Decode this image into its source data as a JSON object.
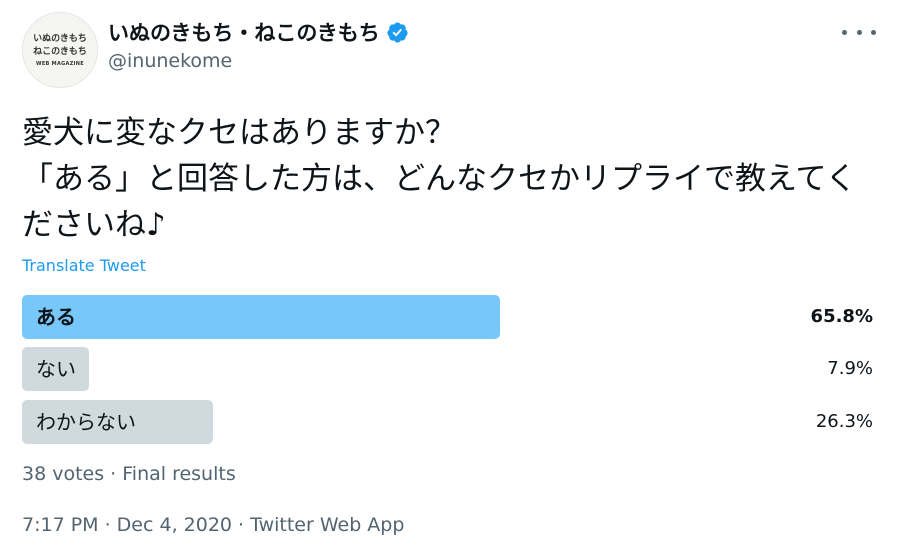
{
  "author": {
    "display_name": "いぬのきもち・ねこのきもち",
    "handle": "@inunekome",
    "avatar_lines": [
      "いぬのきもち",
      "ねこのきもち",
      "WEB MAGAZINE"
    ],
    "verified_icon": "verified-badge-icon"
  },
  "tweet": {
    "text": "愛犬に変なクセはありますか？\n「ある」と回答した方は、どんなクセかリプライで教えてくださいね♪",
    "translate_link": "Translate Tweet"
  },
  "poll": {
    "options": [
      {
        "label": "ある",
        "percent": "65.8%",
        "fraction": 0.658,
        "winner": true
      },
      {
        "label": "ない",
        "percent": "7.9%",
        "fraction": 0.079,
        "winner": false
      },
      {
        "label": "わからない",
        "percent": "26.3%",
        "fraction": 0.263,
        "winner": false
      }
    ],
    "summary": "38 votes · Final results"
  },
  "meta": {
    "timestamp": "7:17 PM · Dec 4, 2020 · Twitter Web App"
  },
  "colors": {
    "winner_bar": "#78c7fb",
    "other_bar": "#cfd9de",
    "link": "#1d9bf0",
    "secondary_text": "#536471",
    "verified": "#1d9bf0"
  }
}
